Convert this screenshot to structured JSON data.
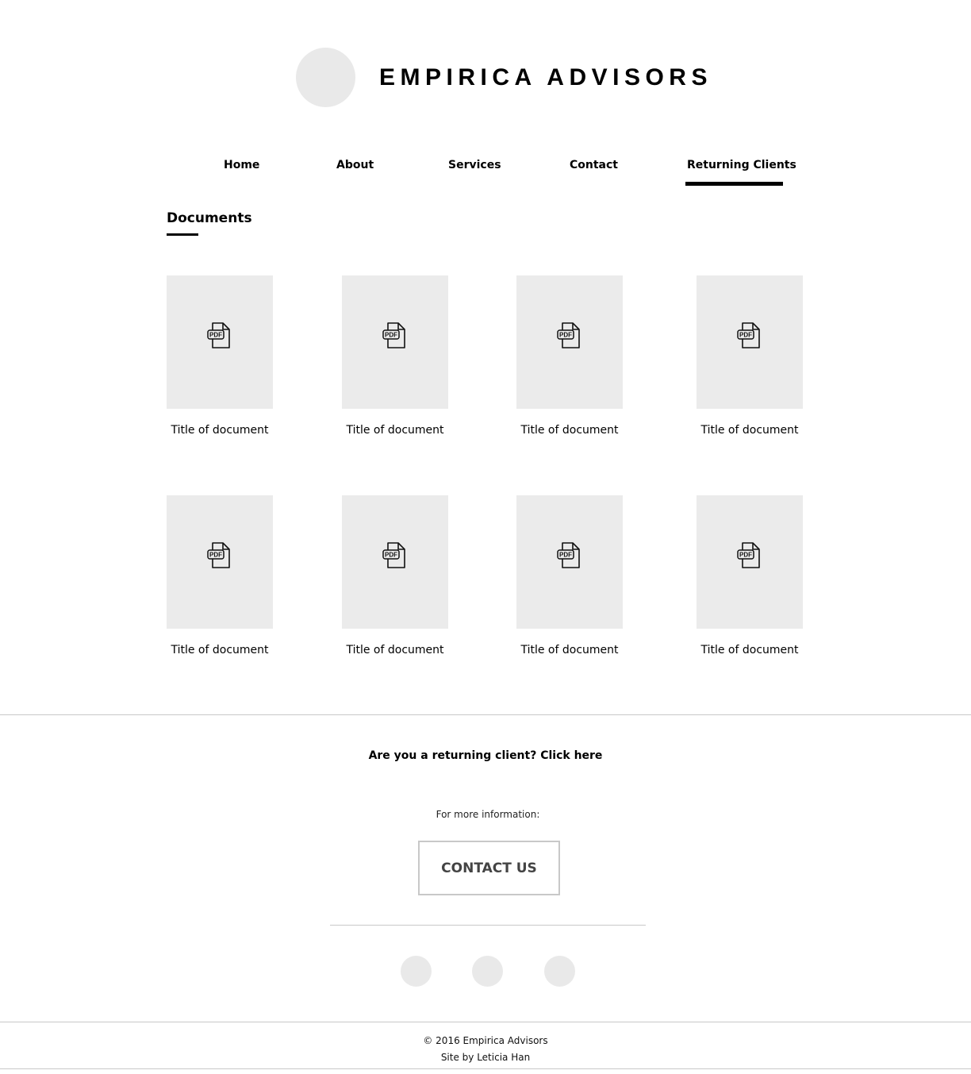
{
  "header": {
    "brand": "EMPIRICA ADVISORS",
    "logo_icon": "logo-placeholder-circle"
  },
  "nav": {
    "items": [
      {
        "label": "Home"
      },
      {
        "label": "About"
      },
      {
        "label": "Services"
      },
      {
        "label": "Contact"
      },
      {
        "label": "Returning Clients"
      }
    ],
    "active": "Returning Clients"
  },
  "main": {
    "section_title": "Documents",
    "documents": [
      {
        "title": "Title of document",
        "icon": "pdf-file-icon"
      },
      {
        "title": "Title of document",
        "icon": "pdf-file-icon"
      },
      {
        "title": "Title of document",
        "icon": "pdf-file-icon"
      },
      {
        "title": "Title of document",
        "icon": "pdf-file-icon"
      },
      {
        "title": "Title of document",
        "icon": "pdf-file-icon"
      },
      {
        "title": "Title of document",
        "icon": "pdf-file-icon"
      },
      {
        "title": "Title of document",
        "icon": "pdf-file-icon"
      },
      {
        "title": "Title of document",
        "icon": "pdf-file-icon"
      }
    ],
    "pdf_label": "PDF"
  },
  "cta": {
    "returning_text": "Are you a returning client? Click here",
    "more_info": "For more information:",
    "contact_button": "CONTACT US"
  },
  "social": {
    "icons": [
      "social-icon-placeholder",
      "social-icon-placeholder",
      "social-icon-placeholder"
    ]
  },
  "footer": {
    "copyright": "© 2016 Empirica Advisors",
    "credit": "Site by Leticia Han"
  },
  "colors": {
    "placeholder_gray": "#ebebeb",
    "divider": "#c8c8c8",
    "text": "#000000"
  }
}
